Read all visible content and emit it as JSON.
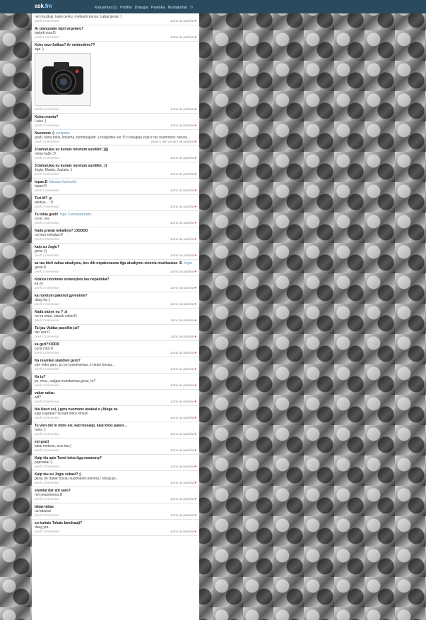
{
  "header": {
    "logo": "ask",
    "logo_suffix": ".fm",
    "nav": [
      "Klausimai (1)",
      "Profilis",
      "Draugai",
      "Paieška",
      "Nustatymai"
    ]
  },
  "feed": [
    {
      "q": "",
      "a": "net muzikaij, katei perku, metkami kanos. Labai geras :)",
      "time": "prieš 3 mėnesius",
      "like": "Jums tai patinka"
    },
    {
      "q": "Ar planuojate tapti vegetaru?",
      "a": "biskėk nisa:D",
      "time": "prieš 3 mėnesius",
      "like": "Jums tai patinka"
    },
    {
      "q": "Koks tavo fotikas? Ar veidrodinis??",
      "a": "aga :)",
      "photo": true,
      "time": "prieš 3 mėnesius",
      "like": "Jums tai patinka"
    },
    {
      "q": "Kokiu mantu?",
      "a": "Lukui :)",
      "time": "prieš 3 mėnesius",
      "like": "Jums tai patinka"
    },
    {
      "q": "Nuomonė :)",
      "asker": "cuniperis",
      "a": "graži, faina tokia, linksma, bendraujanti :) zvaigzdes esi :D o daugiau kaip ir nei nuomonės neturiu...",
      "time": "prieš 3 mėnesius",
      "like": "Jums ir dar vienam tai patinka",
      "liker": "dar vienam"
    },
    {
      "q": "3 bahurukai su kuriais noretum susitikti :))))",
      "a": "neisu kažk.:D",
      "time": "prieš 3 mėnesius",
      "like": "Jums tai patinka"
    },
    {
      "q": "3 bahurukai su kuriais noretum susitikti. :))",
      "a": "Jogiu, Mantu, Justuku :)",
      "time": "prieš 3 mėnesius",
      "like": "Jums tai patinka"
    },
    {
      "q": "lopas:D",
      "asker": "Mantas Kulnockis",
      "a": "lopas:D",
      "time": "prieš 3 mėnesius",
      "like": "Jums tai patinka"
    },
    {
      "q": "Turi bf? ;p",
      "a": "atsikus... :D",
      "time": "prieš 3 mėnesius",
      "like": "Jums tai patinka"
    },
    {
      "q": "Tu tokia graži!",
      "asker": "Inga Cumulatarkaitė",
      "a": "oj ne. ner.",
      "time": "prieš 3 mėnesius",
      "like": "Jums tai patinka"
    },
    {
      "q": "Kada pranai nekalbys? :DDDDD",
      "a": "no favo nekalas:D",
      "time": "prieš 3 mėnesius",
      "like": "Jums tai patinka"
    },
    {
      "q": "kaip su Jogiu?",
      "a": "gerai :))",
      "time": "prieš 3 mėnesius",
      "like": "Jums tai patinka"
    },
    {
      "q": "as tau bieli valiau atsakysiu, bes dib nepakenauna ilgu atsakymu siuncia muzikaukas :D",
      "asker": "Jogiu",
      "a": "gerai:D",
      "time": "prieš 3 mėnesius",
      "like": "Jums tai patinka"
    },
    {
      "q": "Kokios istorimės zemenybės tau nepatinka?",
      "a": "ka zn",
      "time": "prieš 3 mėnesius",
      "like": "Jums tai patinka"
    },
    {
      "q": "ka noretum pakeisti gyvenime?",
      "a": "daug ka :)",
      "time": "prieš 3 mėnesius",
      "like": "Jums tai patinka"
    },
    {
      "q": "Kada siutye nu ? :d",
      "a": "nu ka znau, klausk valdo:D",
      "time": "prieš 3 mėnesius",
      "like": "Jums tai patinka"
    },
    {
      "q": "Tai jau Valdas paselžie jai?",
      "a": "dar nez:D",
      "time": "prieš 3 mėnesius",
      "like": "Jums tai patinka"
    },
    {
      "q": "ka geri?:DDDD",
      "a": "coca cola:D",
      "time": "prieš 3 mėnesius",
      "like": "Jums tai patinka"
    },
    {
      "q": "Ka nuveikei siandien gero?",
      "a": "vpe reiko garo, pc po prasimaniau, ir lauko buvau...",
      "time": "prieš 3 mėnesius",
      "like": "Jums tai patinka"
    },
    {
      "q": "Ka tu?",
      "a": "pc, muz., valgau mandarinus,gorui, tu?",
      "time": "prieš 3 mėnesius",
      "like": "Jums tai patinka"
    },
    {
      "q": "vakar ratiau",
      "a": "wtf?",
      "time": "prieš 3 mėnesius",
      "like": "Jums tai patinka"
    },
    {
      "q": "bla žiauri esi, į gera nuomone atsakai o į bloga ne",
      "a": "kaip supratai? tai kad reiko rimeiio",
      "time": "prieš 3 mėnesius",
      "like": "Jums tai patinka"
    },
    {
      "q": "Tu vien del to mido esi, kad mesaigi, kaip kitos panos ..",
      "a": "hoho :)",
      "time": "prieš 3 mėnesius",
      "like": "Jums tai patinka"
    },
    {
      "q": "esi graži",
      "a": "labai motonu, aciu tau:)",
      "time": "prieš 3 mėnesius",
      "like": "Jums tai patinka"
    },
    {
      "q": "Kaip čia apie Tomė tokia ilgą nuomonę?",
      "a": "paprastai :)",
      "time": "prieš 3 mėnesius",
      "like": "Jums tai patinka"
    },
    {
      "q": "Kaip tau su Jogiu sekasi? ;)",
      "a": "gerai, tik dabar nozau susitinkam,nervina,/ siorga jis..",
      "time": "prieš 3 mėnesius",
      "like": "Jums tai patinka"
    },
    {
      "q": "stumiat dar ant saro?",
      "a": "net neatsimenu:D",
      "time": "prieš 3 mėnesius",
      "like": "Jums tai patinka"
    },
    {
      "q": "labas labas",
      "a": "nu labukai",
      "time": "prieš 3 mėnesius",
      "like": "Jums tai patinka"
    },
    {
      "q": "su kuriais Tokais bendrauji?",
      "a": "daug yra.",
      "time": "prieš 3 mėnesius",
      "like": "Jums tai patinka"
    }
  ]
}
